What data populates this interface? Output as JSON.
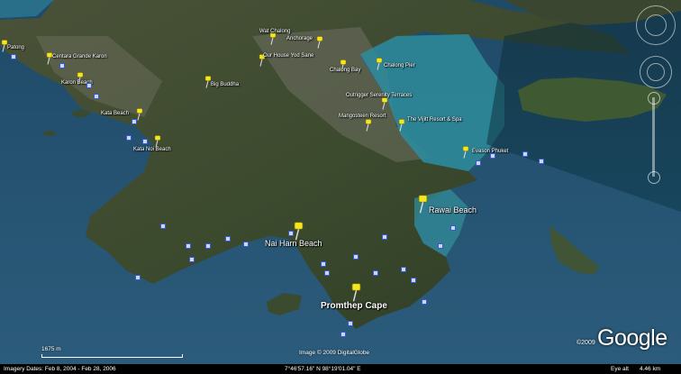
{
  "map": {
    "places": [
      {
        "id": "patong",
        "label": "Patong"
      },
      {
        "id": "centara",
        "label": "Centara Grande Karon"
      },
      {
        "id": "karon",
        "label": "Karon Beach"
      },
      {
        "id": "kata",
        "label": "Kata Beach"
      },
      {
        "id": "katanoi",
        "label": "Kata Noi Beach"
      },
      {
        "id": "bigbuddha",
        "label": "Big Buddha"
      },
      {
        "id": "wat",
        "label": "Wat Chalong"
      },
      {
        "id": "anchorage",
        "label": "Anchorage"
      },
      {
        "id": "ourhouse",
        "label": "Our House Yod Sane"
      },
      {
        "id": "chalongbay",
        "label": "Chalong Bay"
      },
      {
        "id": "chalongpier",
        "label": "Chalong Pier"
      },
      {
        "id": "outrigger",
        "label": "Outrigger Serenity Terraces"
      },
      {
        "id": "mangosteen",
        "label": "Mangosteen Resort"
      },
      {
        "id": "vijitt",
        "label": "The Vijitt Resort & Spa"
      },
      {
        "id": "evason",
        "label": "Evason Phuket"
      },
      {
        "id": "rawai",
        "label": "Rawai Beach"
      },
      {
        "id": "naiharn",
        "label": "Nai Harn Beach"
      },
      {
        "id": "promthep",
        "label": "Promthep Cape"
      }
    ]
  },
  "overlay": {
    "scale_label": "1675 m",
    "imagery_credit": "Image © 2009 DigitalGlobe",
    "logo_text": "Google",
    "logo_copyright": "©2009"
  },
  "statusbar": {
    "imagery_dates": "Imagery Dates: Feb 8, 2004 - Feb 28, 2006",
    "coordinates": "7°46'57.16\" N    98°19'01.04\" E",
    "eye_alt": "Eye alt",
    "eye_alt_value": "4.46 km"
  },
  "colors": {
    "sea": "#2c5a78",
    "shallow": "#2f8f9a",
    "land": "#3a4a30",
    "pin": "#f4e620"
  }
}
